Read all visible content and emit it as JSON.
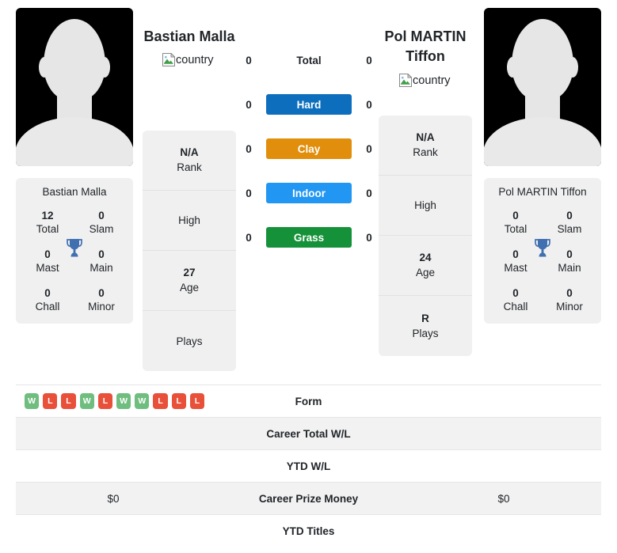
{
  "players": {
    "left": {
      "name": "Bastian Malla",
      "caption": "Bastian Malla",
      "country_alt": "country",
      "photo_alt": "Bastian Malla",
      "rank": "N/A",
      "rank_label": "Rank",
      "high": "",
      "high_label": "High",
      "age": "27",
      "age_label": "Age",
      "plays": "",
      "plays_label": "Plays",
      "titles": {
        "total": "12",
        "total_label": "Total",
        "slam": "0",
        "slam_label": "Slam",
        "mast": "0",
        "mast_label": "Mast",
        "main": "0",
        "main_label": "Main",
        "chall": "0",
        "chall_label": "Chall",
        "minor": "0",
        "minor_label": "Minor"
      }
    },
    "right": {
      "name": "Pol MARTIN Tiffon",
      "caption": "Pol MARTIN Tiffon",
      "country_alt": "country",
      "photo_alt": "Pol MARTIN Tiffon",
      "rank": "N/A",
      "rank_label": "Rank",
      "high": "",
      "high_label": "High",
      "age": "24",
      "age_label": "Age",
      "plays": "R",
      "plays_label": "Plays",
      "titles": {
        "total": "0",
        "total_label": "Total",
        "slam": "0",
        "slam_label": "Slam",
        "mast": "0",
        "mast_label": "Mast",
        "main": "0",
        "main_label": "Main",
        "chall": "0",
        "chall_label": "Chall",
        "minor": "0",
        "minor_label": "Minor"
      }
    }
  },
  "surfaces": [
    {
      "label": "Total",
      "left": "0",
      "right": "0",
      "color": "",
      "plain": true
    },
    {
      "label": "Hard",
      "left": "0",
      "right": "0",
      "color": "#0d6ebd",
      "plain": false
    },
    {
      "label": "Clay",
      "left": "0",
      "right": "0",
      "color": "#e08e0b",
      "plain": false
    },
    {
      "label": "Indoor",
      "left": "0",
      "right": "0",
      "color": "#2196f3",
      "plain": false
    },
    {
      "label": "Grass",
      "left": "0",
      "right": "0",
      "color": "#159139",
      "plain": false
    }
  ],
  "comparison_rows": [
    {
      "label": "Form",
      "left": "",
      "right": "",
      "type": "form"
    },
    {
      "label": "Career Total W/L",
      "left": "",
      "right": "",
      "type": "text"
    },
    {
      "label": "YTD W/L",
      "left": "",
      "right": "",
      "type": "text"
    },
    {
      "label": "Career Prize Money",
      "left": "$0",
      "right": "$0",
      "type": "text"
    },
    {
      "label": "YTD Titles",
      "left": "",
      "right": "",
      "type": "text"
    }
  ],
  "form": {
    "left": [
      "W",
      "L",
      "L",
      "W",
      "L",
      "W",
      "W",
      "L",
      "L",
      "L"
    ],
    "right": []
  },
  "colors": {
    "win": "#6fbe7f",
    "loss": "#e8503a",
    "trophy": "#4070b0",
    "panel_bg": "#f0f0f0",
    "stripe_bg": "#f2f2f2"
  },
  "icons": {
    "trophy": "trophy-icon",
    "broken_image": "broken-image-icon"
  }
}
